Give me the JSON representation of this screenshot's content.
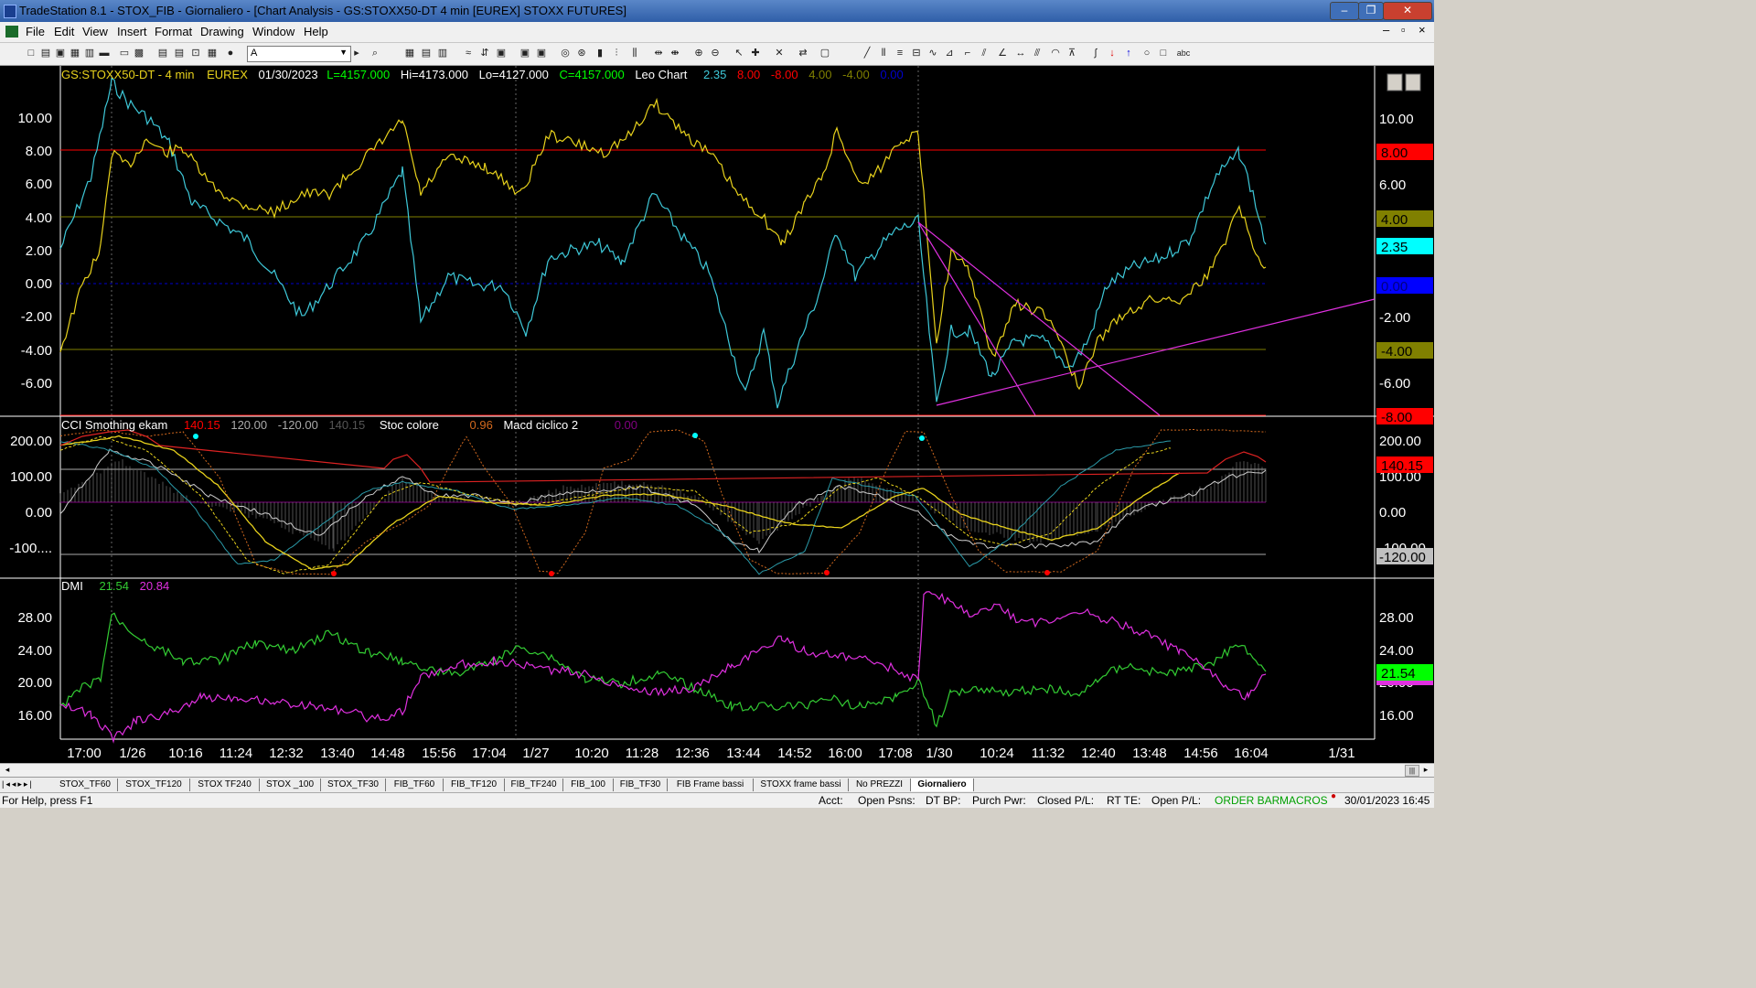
{
  "window": {
    "title": "TradeStation 8.1 - STOX_FIB - Giornaliero - [Chart Analysis - GS:STOXX50-DT  4 min  [EUREX] STOXX FUTURES]",
    "minimize": "‒",
    "restore": "❐",
    "close": "✕"
  },
  "menu": [
    "File",
    "Edit",
    "View",
    "Insert",
    "Format",
    "Drawing",
    "Window",
    "Help"
  ],
  "mdi_buttons": [
    "–",
    "▫",
    "×"
  ],
  "toolbar": {
    "font_value": "A"
  },
  "chart": {
    "header": {
      "symbol": "GS:STOXX50-DT - 4 min",
      "exchange": "EUREX",
      "date": "01/30/2023",
      "last": "L=4157.000",
      "hi": "Hi=4173.000",
      "lo": "Lo=4127.000",
      "close": "C=4157.000",
      "study": "Leo Chart",
      "v1": "2.35",
      "v2": "8.00",
      "v3": "-8.00",
      "v4": "4.00",
      "v5": "-4.00",
      "v6": "0.00"
    },
    "panel1": {
      "y_ticks": [
        "10.00",
        "8.00",
        "6.00",
        "4.00",
        "2.00",
        "0.00",
        "-2.00",
        "-4.00",
        "-6.00"
      ],
      "right_ticks": [
        "10.00",
        "6.00",
        "-2.00",
        "-6.00"
      ],
      "markers": [
        {
          "label": "8.00",
          "bg": "#ff0000",
          "fg": "#000000"
        },
        {
          "label": "4.00",
          "bg": "#808000",
          "fg": "#000000"
        },
        {
          "label": "2.35",
          "bg": "#00ffff",
          "fg": "#000000"
        },
        {
          "label": "0.00",
          "bg": "#0000ff",
          "fg": "#000080"
        },
        {
          "label": "-4.00",
          "bg": "#808000",
          "fg": "#000000"
        },
        {
          "label": "-8.00",
          "bg": "#ff0000",
          "fg": "#000000"
        }
      ]
    },
    "panel2": {
      "header": {
        "name": "CCI Smothing ekam",
        "v1": "140.15",
        "v2": "120.00",
        "v3": "-120.00",
        "v4": "140.15",
        "name2": "Stoc colore",
        "v5": "0.96",
        "name3": "Macd ciclico 2",
        "v6": "0.00"
      },
      "y_ticks": [
        "200.00",
        "100.00",
        "0.00",
        "-100...."
      ],
      "right_ticks": [
        "200.00",
        "100.00",
        "0.00",
        "-100.00"
      ],
      "markers": [
        {
          "label": "140.15",
          "bg": "#ff0000",
          "fg": "#000000"
        },
        {
          "label": "-120.00",
          "bg": "#c0c0c0",
          "fg": "#000000"
        }
      ]
    },
    "panel3": {
      "header": {
        "name": "DMI",
        "v1": "21.54",
        "v2": "20.84"
      },
      "y_ticks": [
        "28.00",
        "24.00",
        "20.00",
        "16.00"
      ],
      "right_ticks": [
        "28.00",
        "24.00",
        "20.00",
        "16.00"
      ],
      "markers": [
        {
          "label": "21.54",
          "bg": "#00ff00",
          "fg": "#000000"
        }
      ]
    },
    "x_labels": [
      "17:00",
      "1/26",
      "10:16",
      "11:24",
      "12:32",
      "13:40",
      "14:48",
      "15:56",
      "17:04",
      "1/27",
      "10:20",
      "11:28",
      "12:36",
      "13:44",
      "14:52",
      "16:00",
      "17:08",
      "1/30",
      "10:24",
      "11:32",
      "12:40",
      "13:48",
      "14:56",
      "16:04",
      "1/31"
    ],
    "colors": {
      "cyan": "#3ec8d8",
      "yellow": "#e8d21c",
      "magenta": "#e030e0",
      "red": "#ff0000",
      "olive": "#808000",
      "green": "#33cc33"
    }
  },
  "tabs": [
    "STOX_TF60",
    "STOX_TF120",
    "STOX TF240",
    "STOX _100",
    "STOX_TF30",
    "FIB_TF60",
    "FIB_TF120",
    "FIB_TF240",
    "FIB_100",
    "FIB_TF30",
    "FIB Frame bassi",
    "STOXX frame bassi",
    "No PREZZI",
    "Giornaliero"
  ],
  "status": {
    "help": "For Help, press F1",
    "acct": "Acct:",
    "open_psns": "Open Psns:",
    "dt_bp": "DT BP:",
    "purch_pwr": "Purch Pwr:",
    "closed_pl": "Closed P/L:",
    "rt_te": "RT TE:",
    "open_pl": "Open P/L:",
    "order_bar": "ORDER BAR",
    "macros": "MACROS",
    "datetime": "30/01/2023 16:45"
  }
}
